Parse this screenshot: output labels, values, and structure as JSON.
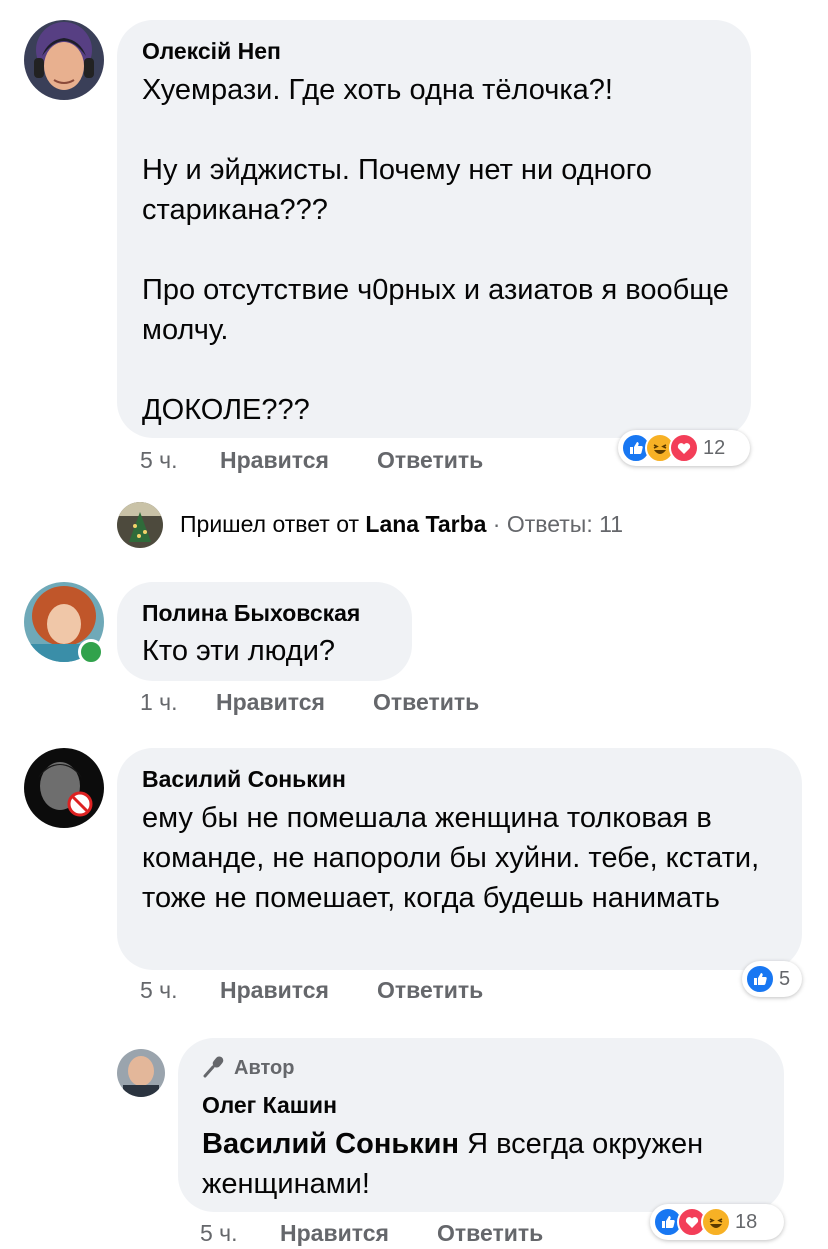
{
  "colors": {
    "bubble": "#f0f2f5",
    "meta": "#65676b",
    "like": "#1877f2",
    "love": "#f33e58",
    "haha": "#f7b125",
    "online": "#31a24c"
  },
  "comments": [
    {
      "author": "Олексій Неп",
      "text": "Хуемрази. Где хоть одна тёлочка?!\n\nНу и эйджисты. Почему нет ни одного старикана???\n\nПро отсутствие ч0рных и азиатов я вообще молчу.\n\nДОКОЛЕ???",
      "time": "5 ч.",
      "like_label": "Нравится",
      "reply_label": "Ответить",
      "reactions": {
        "icons": [
          "like-icon",
          "haha-icon",
          "love-icon"
        ],
        "count": "12"
      },
      "replies_summary": {
        "prefix": "Пришел ответ от",
        "name": "Lana Tarba",
        "separator": "·",
        "count_label": "Ответы: 11"
      }
    },
    {
      "author": "Полина Быховская",
      "text": "Кто эти люди?",
      "time": "1 ч.",
      "like_label": "Нравится",
      "reply_label": "Ответить"
    },
    {
      "author": "Василий Сонькин",
      "text": "ему бы не помешала женщина толковая в команде, не напороли бы хуйни. тебе, кстати, тоже не помешает, когда будешь нанимать",
      "time": "5 ч.",
      "like_label": "Нравится",
      "reply_label": "Ответить",
      "reactions": {
        "icons": [
          "like-icon"
        ],
        "count": "5"
      }
    },
    {
      "badge": "Автор",
      "author": "Олег Кашин",
      "mention": "Василий Сонькин",
      "text": " Я всегда окружен женщинами!",
      "time": "5 ч.",
      "like_label": "Нравится",
      "reply_label": "Ответить",
      "reactions": {
        "icons": [
          "like-icon",
          "love-icon",
          "haha-icon"
        ],
        "count": "18"
      }
    }
  ]
}
